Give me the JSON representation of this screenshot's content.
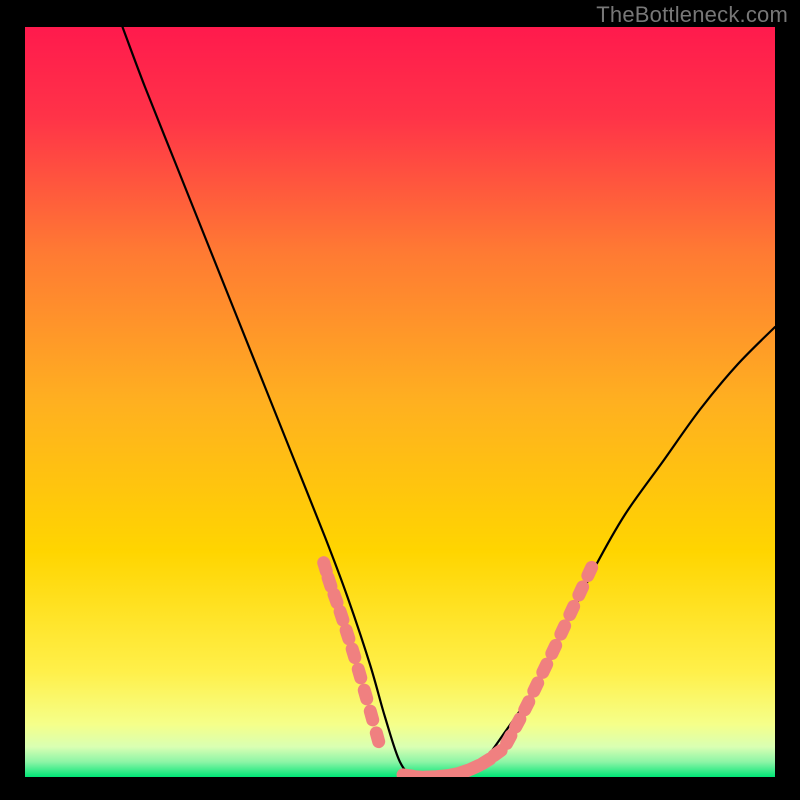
{
  "watermark": "TheBottleneck.com",
  "chart_data": {
    "type": "line",
    "title": "",
    "xlabel": "",
    "ylabel": "",
    "xlim": [
      0,
      100
    ],
    "ylim": [
      0,
      100
    ],
    "grid": false,
    "background_gradient": {
      "top_color": "#ff1a4d",
      "mid_color": "#ffd500",
      "bottom_edge_color": "#00e676"
    },
    "series": [
      {
        "name": "curve",
        "color": "#000000",
        "x": [
          13,
          16,
          20,
          24,
          28,
          32,
          36,
          40,
          43,
          46,
          48,
          50,
          52,
          55,
          58,
          61,
          64,
          68,
          72,
          76,
          80,
          85,
          90,
          95,
          100
        ],
        "y": [
          100,
          92,
          82,
          72,
          62,
          52,
          42,
          32,
          24,
          15,
          8,
          2,
          0,
          0,
          0,
          2,
          6,
          12,
          20,
          28,
          35,
          42,
          49,
          55,
          60
        ]
      },
      {
        "name": "left-marker-cluster",
        "type": "scatter",
        "color": "#f08080",
        "x": [
          40.0,
          40.6,
          41.4,
          42.2,
          43.0,
          43.8,
          44.6,
          45.4,
          46.2,
          47.0
        ],
        "y": [
          28.0,
          26.0,
          23.8,
          21.5,
          19.0,
          16.5,
          13.8,
          11.0,
          8.2,
          5.3
        ]
      },
      {
        "name": "bottom-marker-cluster",
        "type": "scatter",
        "color": "#f08080",
        "x": [
          51.0,
          52.5,
          54.0,
          55.5,
          57.0,
          58.5,
          60.0,
          61.5,
          63.0
        ],
        "y": [
          0.2,
          0.0,
          0.0,
          0.1,
          0.3,
          0.7,
          1.3,
          2.1,
          3.2
        ]
      },
      {
        "name": "right-marker-cluster",
        "type": "scatter",
        "color": "#f08080",
        "x": [
          64.5,
          65.7,
          66.9,
          68.1,
          69.3,
          70.5,
          71.7,
          72.9,
          74.1,
          75.3
        ],
        "y": [
          5.0,
          7.2,
          9.5,
          12.0,
          14.5,
          17.0,
          19.6,
          22.2,
          24.8,
          27.4
        ]
      }
    ]
  }
}
